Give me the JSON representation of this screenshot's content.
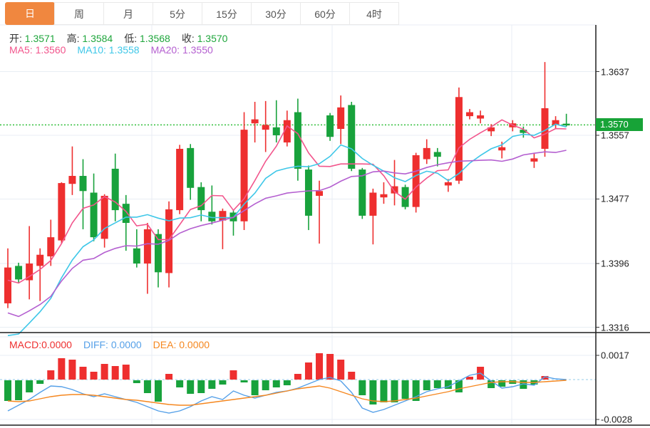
{
  "tabs": {
    "items": [
      {
        "id": "day",
        "label": "日",
        "active": true
      },
      {
        "id": "week",
        "label": "周",
        "active": false
      },
      {
        "id": "month",
        "label": "月",
        "active": false
      },
      {
        "id": "5min",
        "label": "5分",
        "active": false
      },
      {
        "id": "15min",
        "label": "15分",
        "active": false
      },
      {
        "id": "30min",
        "label": "30分",
        "active": false
      },
      {
        "id": "60min",
        "label": "60分",
        "active": false
      },
      {
        "id": "4hour",
        "label": "4时",
        "active": false
      }
    ]
  },
  "ohlc_header": {
    "open_label": "开:",
    "open": "1.3571",
    "high_label": "高:",
    "high": "1.3584",
    "low_label": "低:",
    "low": "1.3568",
    "close_label": "收:",
    "close": "1.3570"
  },
  "ma_header": {
    "ma5_label": "MA5:",
    "ma5": "1.3560",
    "ma10_label": "MA10:",
    "ma10": "1.3558",
    "ma20_label": "MA20:",
    "ma20": "1.3550"
  },
  "macd_header": {
    "macd_label": "MACD:",
    "macd": "0.0000",
    "diff_label": "DIFF:",
    "diff": "0.0000",
    "dea_label": "DEA:",
    "dea": "0.0000"
  },
  "price_axis": {
    "ticks": [
      {
        "label": "1.3637",
        "price": 1.3637
      },
      {
        "label": "1.3557",
        "price": 1.3557
      },
      {
        "label": "1.3477",
        "price": 1.3477
      },
      {
        "label": "1.3396",
        "price": 1.3396
      },
      {
        "label": "1.3316",
        "price": 1.3316
      }
    ],
    "current": {
      "label": "1.3570",
      "price": 1.357
    }
  },
  "macd_axis": {
    "ticks": [
      {
        "label": "0.0017",
        "value": 0.0017
      },
      {
        "label": "-0.0028",
        "value": -0.0028
      }
    ]
  },
  "colors": {
    "up": "#EE2F2F",
    "down": "#18A23C",
    "ma5": "#F2558C",
    "ma10": "#3EC7E8",
    "ma20": "#B45FD0",
    "diff_line": "#55A0E8",
    "dea_line": "#F5871F",
    "tab_active_bg": "#F0873F",
    "value_green": "#1FA63C",
    "current_line": "#2EBE38",
    "badge_bg": "#17A337",
    "grid": "#E8EEF4",
    "frame": "#1F1F1F",
    "zero_dash": "#ABD7EE"
  },
  "chart_data": {
    "type": "candlestick",
    "description": "Daily FX candlestick chart with MA5/MA10/MA20 overlays and MACD sub-panel",
    "price_panel": {
      "ylim": [
        1.33,
        1.366
      ],
      "tick_prices": [
        1.3637,
        1.3557,
        1.3477,
        1.3396,
        1.3316
      ],
      "current_price": 1.357,
      "ohlc": [
        [
          1.3346,
          1.3415,
          1.334,
          1.3391
        ],
        [
          1.3393,
          1.3397,
          1.3371,
          1.3376
        ],
        [
          1.3375,
          1.3443,
          1.3351,
          1.3396
        ],
        [
          1.3393,
          1.3415,
          1.3349,
          1.3407
        ],
        [
          1.3405,
          1.3451,
          1.3393,
          1.3429
        ],
        [
          1.3425,
          1.3498,
          1.3421,
          1.3497
        ],
        [
          1.3496,
          1.3543,
          1.3482,
          1.3506
        ],
        [
          1.3506,
          1.3527,
          1.3439,
          1.3487
        ],
        [
          1.3485,
          1.3509,
          1.3424,
          1.3429
        ],
        [
          1.3427,
          1.3483,
          1.3416,
          1.3481
        ],
        [
          1.3515,
          1.3534,
          1.3449,
          1.3463
        ],
        [
          1.3471,
          1.3482,
          1.3412,
          1.3447
        ],
        [
          1.3415,
          1.3439,
          1.3391,
          1.3396
        ],
        [
          1.3396,
          1.3447,
          1.3358,
          1.3439
        ],
        [
          1.3433,
          1.3439,
          1.3366,
          1.3385
        ],
        [
          1.3384,
          1.3474,
          1.3366,
          1.3464
        ],
        [
          1.3463,
          1.3545,
          1.3458,
          1.354
        ],
        [
          1.3541,
          1.3546,
          1.3476,
          1.3491
        ],
        [
          1.3492,
          1.3498,
          1.3449,
          1.3463
        ],
        [
          1.3461,
          1.3494,
          1.3445,
          1.3449
        ],
        [
          1.345,
          1.3465,
          1.3414,
          1.3462
        ],
        [
          1.346,
          1.3463,
          1.3431,
          1.3449
        ],
        [
          1.3449,
          1.3586,
          1.3438,
          1.3564
        ],
        [
          1.3572,
          1.3599,
          1.3548,
          1.3577
        ],
        [
          1.3564,
          1.36,
          1.3536,
          1.357
        ],
        [
          1.3567,
          1.3601,
          1.3548,
          1.3557
        ],
        [
          1.3548,
          1.3588,
          1.3543,
          1.3576
        ],
        [
          1.3586,
          1.3603,
          1.35,
          1.3515
        ],
        [
          1.3514,
          1.3519,
          1.3438,
          1.3456
        ],
        [
          1.3481,
          1.35,
          1.3421,
          1.3487
        ],
        [
          1.3582,
          1.3585,
          1.355,
          1.3555
        ],
        [
          1.3565,
          1.3607,
          1.3546,
          1.3592
        ],
        [
          1.3595,
          1.3599,
          1.3512,
          1.3515
        ],
        [
          1.3514,
          1.3516,
          1.3452,
          1.3456
        ],
        [
          1.3456,
          1.349,
          1.342,
          1.3485
        ],
        [
          1.3479,
          1.3498,
          1.3471,
          1.3483
        ],
        [
          1.3484,
          1.3526,
          1.3469,
          1.3493
        ],
        [
          1.3492,
          1.3495,
          1.3464,
          1.3467
        ],
        [
          1.3467,
          1.3535,
          1.346,
          1.3532
        ],
        [
          1.3527,
          1.3552,
          1.3521,
          1.3541
        ],
        [
          1.3536,
          1.3541,
          1.3518,
          1.353
        ],
        [
          1.3494,
          1.3502,
          1.3486,
          1.3498
        ],
        [
          1.35,
          1.3617,
          1.3496,
          1.3605
        ],
        [
          1.3581,
          1.359,
          1.3577,
          1.3586
        ],
        [
          1.3578,
          1.3588,
          1.3572,
          1.3582
        ],
        [
          1.3562,
          1.3571,
          1.3556,
          1.3567
        ],
        [
          1.3538,
          1.3549,
          1.3528,
          1.3542
        ],
        [
          1.3567,
          1.3576,
          1.3562,
          1.3572
        ],
        [
          1.3564,
          1.3568,
          1.3554,
          1.356
        ],
        [
          1.3524,
          1.3534,
          1.3516,
          1.3528
        ],
        [
          1.354,
          1.3649,
          1.353,
          1.3591
        ],
        [
          1.357,
          1.3581,
          1.3565,
          1.3576
        ],
        [
          1.3571,
          1.3584,
          1.3568,
          1.357
        ]
      ],
      "moving_averages": {
        "windows": [
          5,
          10,
          20
        ],
        "computed_from_closes": true,
        "last_values": {
          "ma5": 1.356,
          "ma10": 1.3558,
          "ma20": 1.355
        }
      }
    },
    "macd_panel": {
      "ylim": [
        -0.0032,
        0.002
      ],
      "tick_values": [
        0.0017,
        -0.0028
      ],
      "hist": [
        -0.00145,
        -0.0014,
        -0.00085,
        -0.00025,
        0.00065,
        0.0015,
        0.0014,
        0.0009,
        0.00055,
        0.0011,
        0.00095,
        0.00105,
        -0.0002,
        -0.0009,
        -0.0015,
        0.0004,
        -0.0005,
        -0.00095,
        -0.0009,
        -0.0006,
        -0.0003,
        0.00065,
        -0.00015,
        -0.00105,
        -0.0007,
        -0.0005,
        -0.00035,
        0.0004,
        0.0012,
        0.00185,
        0.0018,
        0.0014,
        0.00055,
        -0.00105,
        -0.0017,
        -0.00155,
        -0.00155,
        -0.0013,
        -0.00145,
        -0.0007,
        -0.00055,
        -0.0006,
        -0.00085,
        0.0002,
        0.0009,
        -0.00055,
        -0.00045,
        -0.00025,
        -0.0006,
        -0.0003,
        0.00025,
        0.0,
        0.0
      ],
      "diff": [
        -0.0022,
        -0.0018,
        -0.0014,
        -0.0009,
        -0.00045,
        -0.0005,
        -0.0007,
        -0.001,
        -0.0012,
        -0.001,
        -0.0012,
        -0.0014,
        -0.0016,
        -0.0019,
        -0.0022,
        -0.00235,
        -0.0022,
        -0.0019,
        -0.0015,
        -0.0012,
        -0.0014,
        -0.0008,
        -0.0011,
        -0.0013,
        -0.0011,
        -0.0009,
        -0.0008,
        -0.0006,
        -0.0003,
        0.0,
        0.00015,
        -0.0001,
        -0.0009,
        -0.002,
        -0.0023,
        -0.0021,
        -0.0018,
        -0.0015,
        -0.0012,
        -0.00085,
        -0.00065,
        -0.0005,
        -0.0001,
        0.0003,
        0.00045,
        -0.0001,
        -0.0006,
        -0.0005,
        -0.0003,
        -0.0004,
        0.0002,
        5e-05,
        0.0
      ],
      "dea": [
        -0.0015,
        -0.00155,
        -0.0015,
        -0.00135,
        -0.0012,
        -0.0011,
        -0.00105,
        -0.00105,
        -0.0011,
        -0.0012,
        -0.0013,
        -0.0014,
        -0.00145,
        -0.00155,
        -0.00165,
        -0.00175,
        -0.0018,
        -0.0018,
        -0.0017,
        -0.0016,
        -0.0015,
        -0.0014,
        -0.0013,
        -0.0012,
        -0.0011,
        -0.00095,
        -0.0008,
        -0.00065,
        -0.00055,
        -0.00045,
        -0.0006,
        -0.00085,
        -0.0011,
        -0.00135,
        -0.0015,
        -0.00155,
        -0.0015,
        -0.0014,
        -0.0013,
        -0.00115,
        -0.001,
        -0.00085,
        -0.00065,
        -0.0005,
        -0.00035,
        -0.0002,
        -0.00015,
        -0.00015,
        -0.0002,
        -0.0002,
        -0.00015,
        -0.0001,
        -5e-05
      ]
    }
  }
}
